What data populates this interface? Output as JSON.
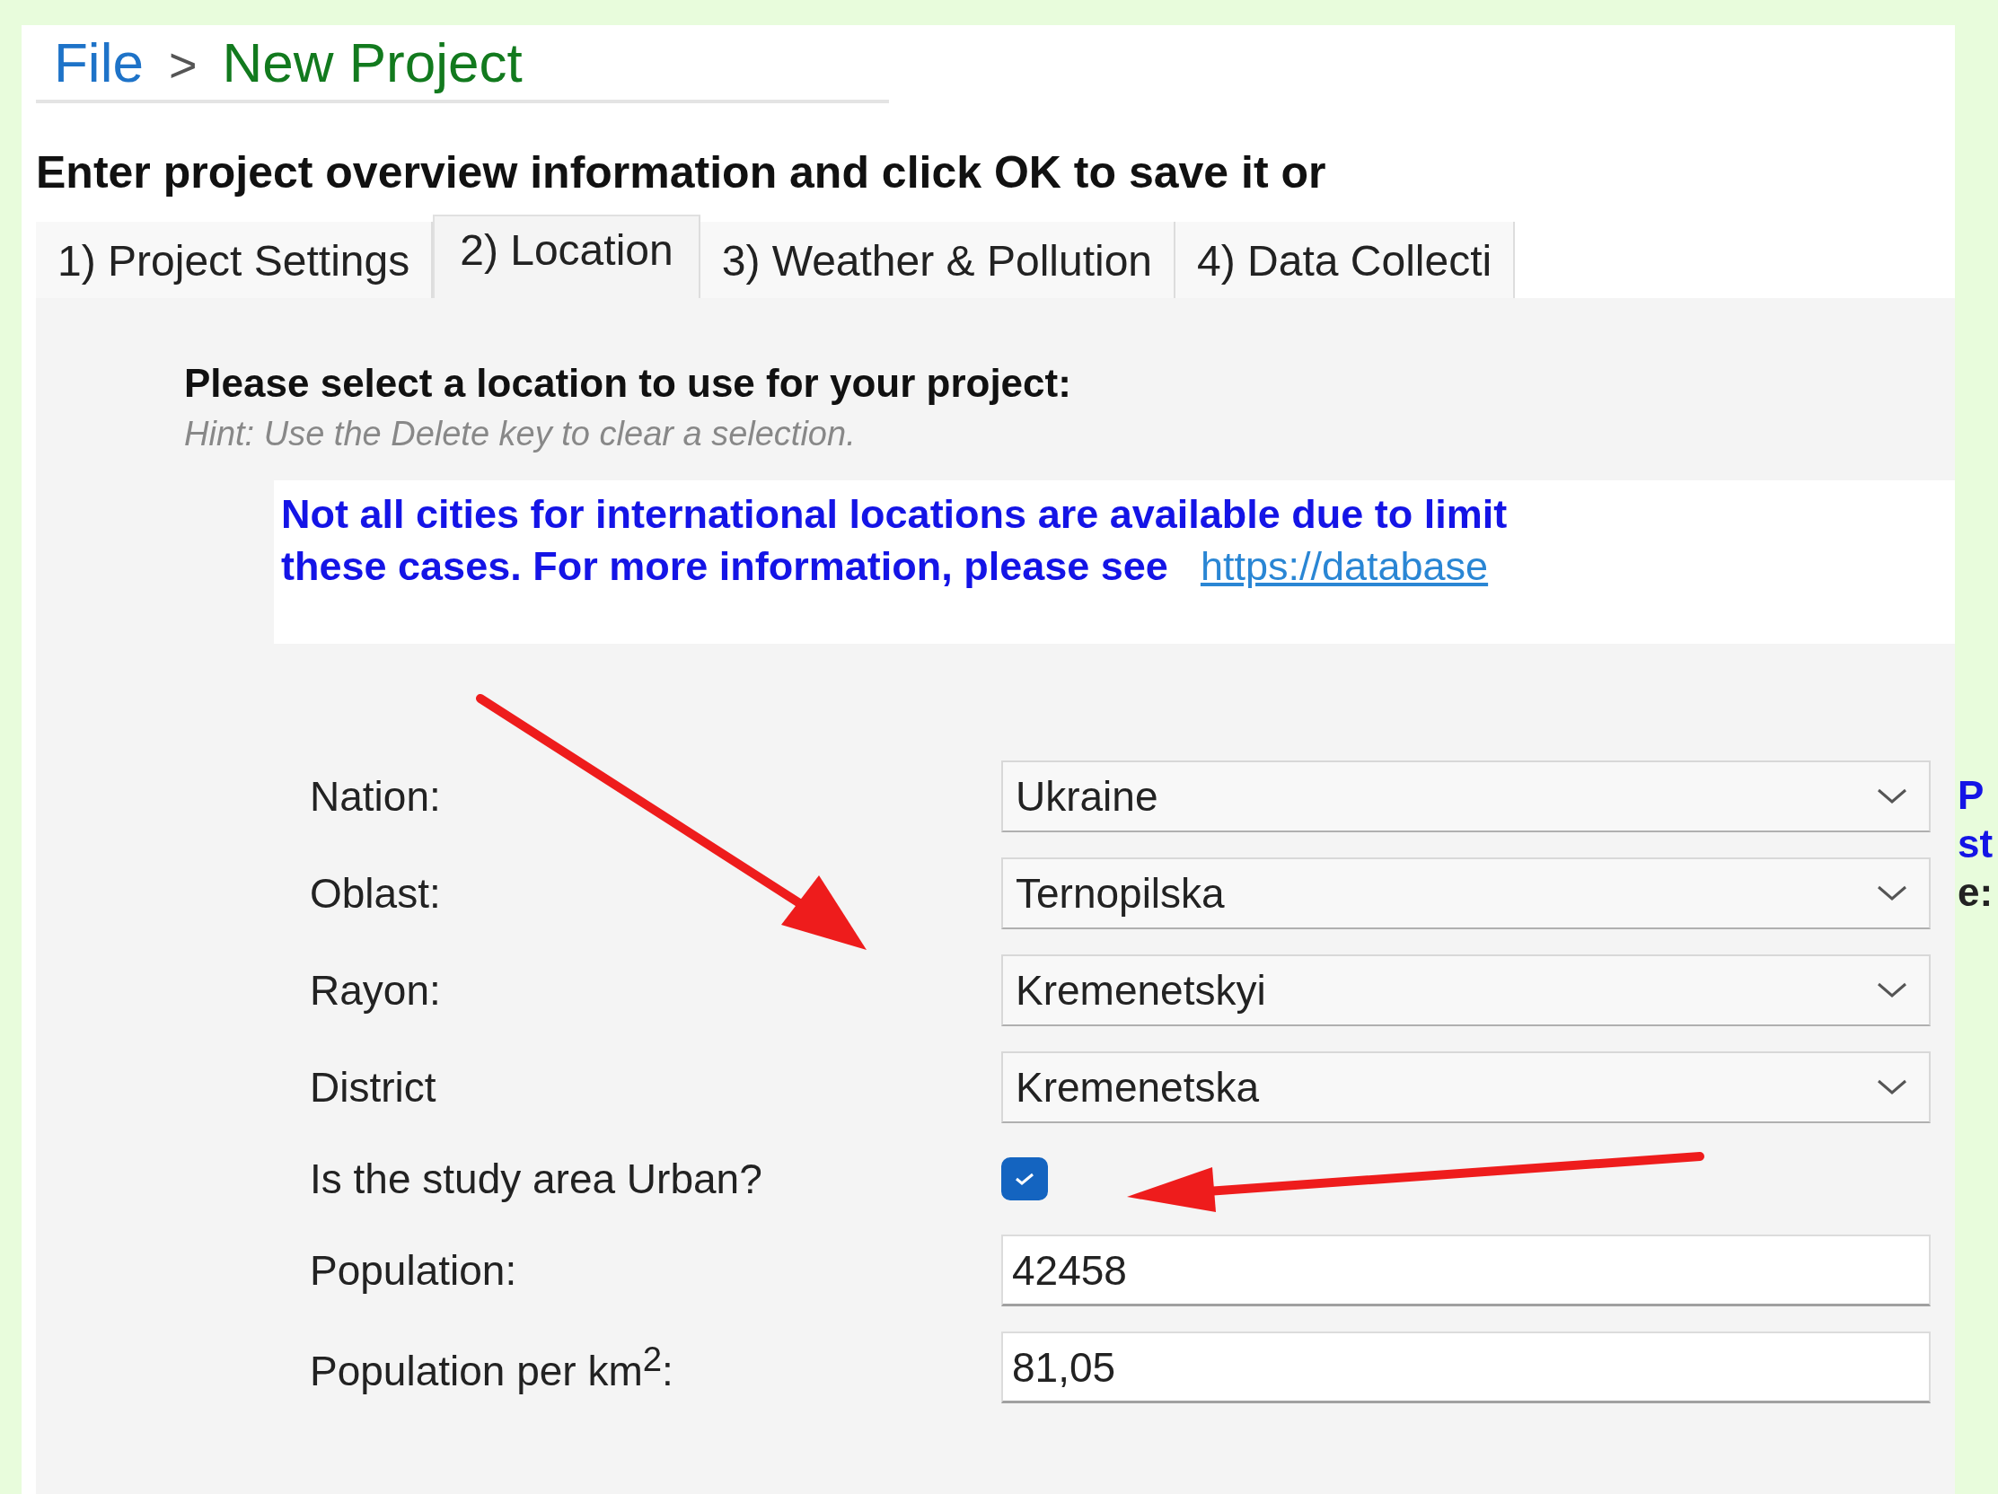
{
  "breadcrumb": {
    "parent": "File",
    "separator": ">",
    "current": "New Project"
  },
  "instruction": "Enter project overview information and click OK to save it or",
  "tabs": [
    {
      "label": "1) Project Settings",
      "selected": false
    },
    {
      "label": "2) Location",
      "selected": true
    },
    {
      "label": "3) Weather & Pollution",
      "selected": false
    },
    {
      "label": "4) Data Collecti",
      "selected": false
    }
  ],
  "section": {
    "title": "Please select a location to use for your project:",
    "hint": "Hint: Use the Delete key to clear a selection."
  },
  "notice": {
    "text": [
      "Not all cities for international locations are available due to limit",
      "these cases. For more information, please see"
    ],
    "link": "https://database"
  },
  "fields": [
    {
      "kind": "dropdown",
      "label": "Nation:",
      "value": "Ukraine"
    },
    {
      "kind": "dropdown",
      "label": "Oblast:",
      "value": "Ternopilska"
    },
    {
      "kind": "dropdown",
      "label": "Rayon:",
      "value": "Kremenetskyi"
    },
    {
      "kind": "dropdown",
      "label": "District",
      "value": "Kremenetska"
    },
    {
      "kind": "checkbox",
      "label": "Is the study area Urban?",
      "checked": true
    },
    {
      "kind": "text",
      "label": "Population:",
      "value": "42458"
    },
    {
      "kind": "text",
      "label": "Population per km$^{2}$:",
      "value": "81,05"
    }
  ],
  "side_note": [
    {
      "text": "P",
      "emphasis": true
    },
    {
      "text": "st",
      "emphasis": true
    },
    {
      "text": "e:",
      "emphasis": false
    }
  ]
}
